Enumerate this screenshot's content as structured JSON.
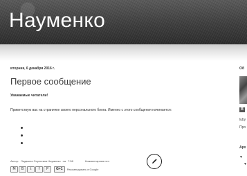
{
  "header": {
    "title": "Науменко"
  },
  "post": {
    "date": "вторник, 6 декабря 2016 г.",
    "title": "Первое сообщение",
    "greeting": "Уважаемые читатели!",
    "body": "Приветствую вас на страничке своего персонального блога. Именно с этого сообщения начинается:",
    "bullet_count": 3
  },
  "footer": {
    "author_prefix": "Автор:",
    "author": "Людмила Сергеевна Науменко",
    "time_prefix": "на",
    "time": "7:58",
    "comments": "Комментариев нет:",
    "recommend": "Рекомендовать в Google"
  },
  "share": {
    "buttons": [
      {
        "label": "M",
        "icon": "email-icon"
      },
      {
        "label": "B",
        "icon": "blog-this-icon"
      },
      {
        "label": "t",
        "icon": "twitter-icon"
      },
      {
        "label": "f",
        "icon": "facebook-icon"
      },
      {
        "label": "P",
        "icon": "pinterest-icon"
      }
    ],
    "gplus": "G+1"
  },
  "sidebar": {
    "heading_1": "Об",
    "blogger_badge": "B",
    "name": "luby",
    "profile": "Про",
    "heading_2": "Арх",
    "archive_1": "▼",
    "archive_2": "▼"
  },
  "colors": {
    "header_bg": "#3e3e3e",
    "header_text": "#ffffff"
  }
}
